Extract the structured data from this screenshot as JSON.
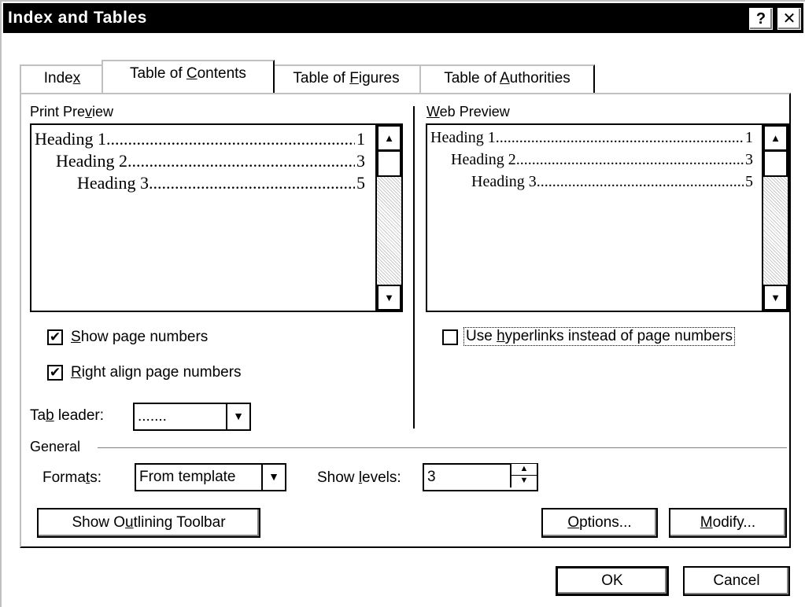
{
  "window": {
    "title": "Index and Tables",
    "help_icon": "?",
    "close_icon": "✕"
  },
  "tabs": [
    {
      "label_pre": "Inde",
      "label_u": "x",
      "label_post": ""
    },
    {
      "label_pre": "Table of ",
      "label_u": "C",
      "label_post": "ontents"
    },
    {
      "label_pre": "Table of ",
      "label_u": "F",
      "label_post": "igures"
    },
    {
      "label_pre": "Table of ",
      "label_u": "A",
      "label_post": "uthorities"
    }
  ],
  "print_preview": {
    "label_pre": "Print Pre",
    "label_u": "v",
    "label_post": "iew",
    "lines": [
      {
        "text": "Heading 1",
        "page": "1"
      },
      {
        "text": "Heading 2",
        "page": "3"
      },
      {
        "text": "Heading 3",
        "page": "5"
      }
    ]
  },
  "web_preview": {
    "label_pre": "",
    "label_u": "W",
    "label_post": "eb Preview",
    "lines": [
      {
        "text": "Heading 1",
        "page": "1"
      },
      {
        "text": "Heading 2",
        "page": "3"
      },
      {
        "text": "Heading 3",
        "page": "5"
      }
    ]
  },
  "options": {
    "show_page_numbers": {
      "checked": true,
      "pre": "",
      "u": "S",
      "post": "how page numbers"
    },
    "right_align": {
      "checked": true,
      "pre": "",
      "u": "R",
      "post": "ight align page numbers"
    },
    "use_hyperlinks": {
      "checked": false,
      "pre": "Use ",
      "u": "h",
      "post": "yperlinks instead of page numbers"
    },
    "tab_leader": {
      "pre": "Ta",
      "u": "b",
      "post": " leader:",
      "value": "......."
    }
  },
  "general": {
    "label": "General",
    "formats": {
      "pre": "Forma",
      "u": "t",
      "post": "s:",
      "value": "From template"
    },
    "show_levels": {
      "pre": "Show ",
      "u": "l",
      "post": "evels:",
      "value": "3"
    }
  },
  "buttons": {
    "outline_toolbar": {
      "pre": "Show O",
      "u": "u",
      "post": "tlining Toolbar"
    },
    "options": {
      "pre": "",
      "u": "O",
      "post": "ptions..."
    },
    "modify": {
      "pre": "",
      "u": "M",
      "post": "odify..."
    },
    "ok": "OK",
    "cancel": "Cancel"
  },
  "icons": {
    "up": "▲",
    "down": "▼",
    "check": "✔"
  }
}
